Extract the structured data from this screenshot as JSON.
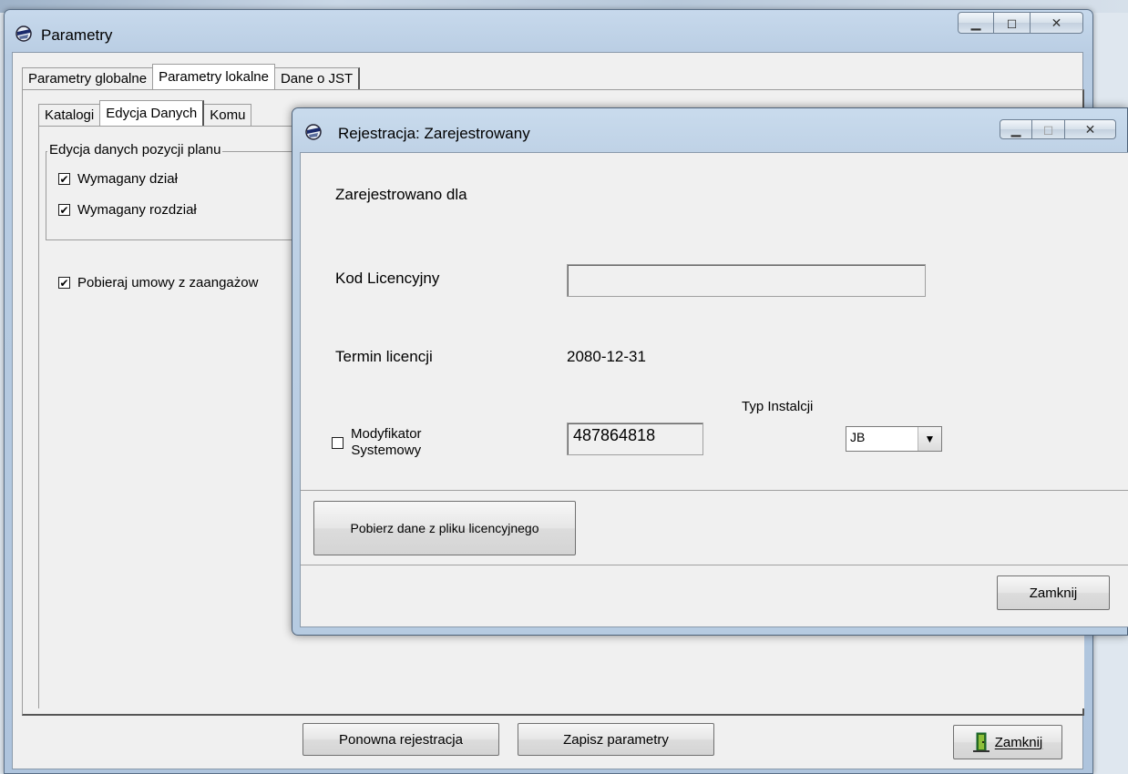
{
  "main_window": {
    "title": "Parametry",
    "tabs": [
      "Parametry globalne",
      "Parametry lokalne",
      "Dane o JST"
    ],
    "sub_tabs": [
      "Katalogi",
      "Edycja Danych",
      "Komu"
    ],
    "group_title": "Edycja danych pozycji planu",
    "checkboxes": [
      {
        "label": "Wymagany dział",
        "checked": "✔"
      },
      {
        "label": "Wymagany rozdział",
        "checked": "✔"
      }
    ],
    "extra_checkbox": {
      "label": "Pobieraj umowy z zaangażow",
      "checked": "✔"
    },
    "buttons": {
      "reregister": "Ponowna rejestracja",
      "save": "Zapisz parametry",
      "close": "Zamknij"
    }
  },
  "dialog": {
    "title": "Rejestracja: Zarejestrowany",
    "registered_for_label": "Zarejestrowano dla",
    "license_code_label": "Kod Licencyjny",
    "license_code_value": "",
    "license_term_label": "Termin licencji",
    "license_term_value": "2080-12-31",
    "install_type_label": "Typ Instalcji",
    "install_type_value": "JB",
    "modifier_label_line1": "Modyfikator",
    "modifier_label_line2": "Systemowy",
    "modifier_value": "487864818",
    "load_button": "Pobierz dane z pliku licencyjnego",
    "close_button": "Zamknij"
  },
  "caption_icons": [
    "minimize-icon",
    "maximize-icon",
    "close-icon"
  ]
}
